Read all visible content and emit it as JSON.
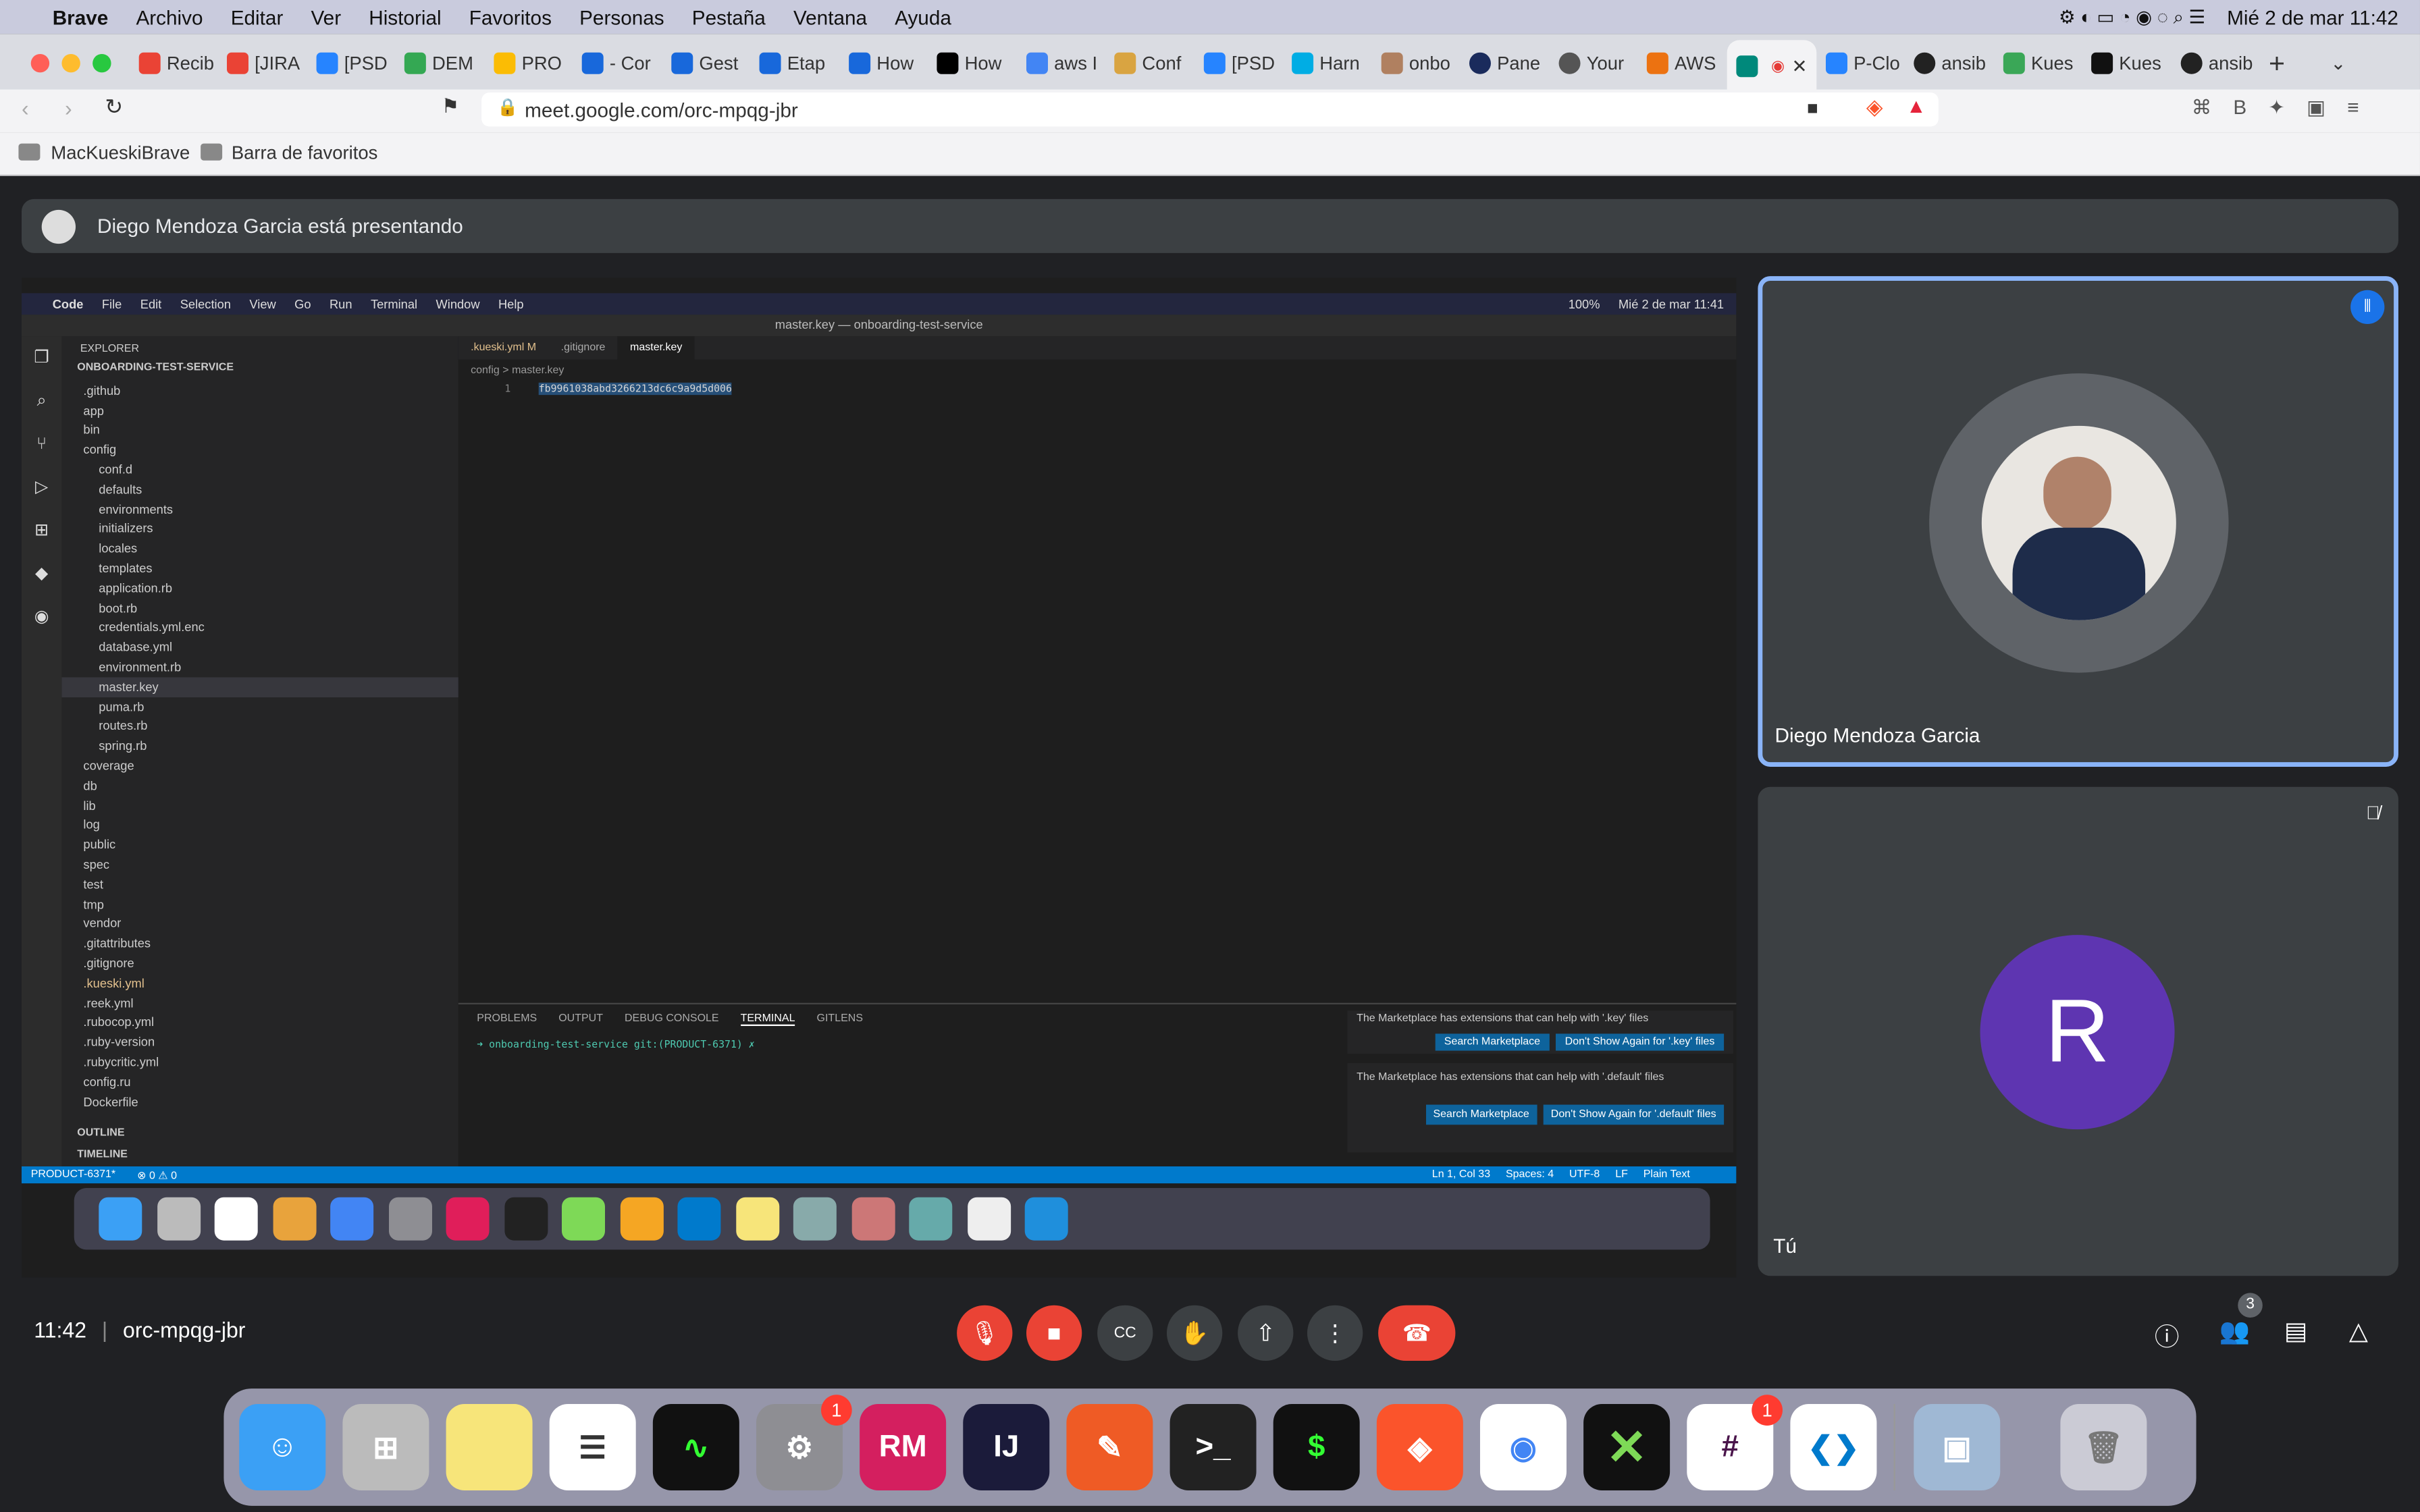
{
  "menubar": {
    "app": "Brave",
    "items": [
      "Archivo",
      "Editar",
      "Ver",
      "Historial",
      "Favoritos",
      "Personas",
      "Pestaña",
      "Ventana",
      "Ayuda"
    ],
    "datetime": "Mié 2 de mar  11:42"
  },
  "tabs": [
    "Recib",
    "[JIRA",
    "[PSD",
    "DEM",
    "PRO",
    "- Cor",
    "Gest",
    "Etap",
    "How",
    "How",
    "aws I",
    "Conf",
    "[PSD",
    "Harn",
    "onbo",
    "Pane",
    "Your",
    "AWS",
    "",
    "P-Clo",
    "ansib",
    "Kues",
    "Kues",
    "ansib"
  ],
  "browser": {
    "url": "meet.google.com/orc-mpqg-jbr",
    "bookmarks": [
      "MacKueskiBrave",
      "Barra de favoritos"
    ]
  },
  "meet": {
    "presenting": "Diego Mendoza Garcia está presentando",
    "participant1": "Diego Mendoza Garcia",
    "participant2": "Tú",
    "initial": "R",
    "time": "11:42",
    "code": "orc-mpqg-jbr",
    "people_count": "3"
  },
  "vscode": {
    "menu": [
      "Code",
      "File",
      "Edit",
      "Selection",
      "View",
      "Go",
      "Run",
      "Terminal",
      "Window",
      "Help"
    ],
    "clock": "Mié 2 de mar 11:41",
    "battery": "100%",
    "title": "master.key — onboarding-test-service",
    "explorer": "EXPLORER",
    "project": "ONBOARDING-TEST-SERVICE",
    "files": [
      ".github",
      "app",
      "bin",
      "config",
      "conf.d",
      "defaults",
      "environments",
      "initializers",
      "locales",
      "templates",
      "application.rb",
      "boot.rb",
      "credentials.yml.enc",
      "database.yml",
      "environment.rb",
      "master.key",
      "puma.rb",
      "routes.rb",
      "spring.rb",
      "coverage",
      "db",
      "lib",
      "log",
      "public",
      "spec",
      "test",
      "tmp",
      "vendor",
      ".gitattributes",
      ".gitignore",
      ".kueski.yml",
      ".reek.yml",
      ".rubocop.yml",
      ".ruby-version",
      ".rubycritic.yml",
      "config.ru",
      "Dockerfile"
    ],
    "outline": "OUTLINE",
    "timeline": "TIMELINE",
    "tabs": [
      ".kueski.yml M",
      ".gitignore",
      "master.key"
    ],
    "breadcrumb": "config  >  master.key",
    "line_no": "1",
    "code": "fb9961038abd3266213dc6c9a9d5d006",
    "panel_tabs": [
      "PROBLEMS",
      "OUTPUT",
      "DEBUG CONSOLE",
      "TERMINAL",
      "GITLENS"
    ],
    "terminal": "➜  onboarding-test-service git:(PRODUCT-6371) ✗",
    "notif1": "The Marketplace has extensions that can help with '.key' files",
    "notif2": "The Marketplace has extensions that can help with '.default' files",
    "btn_search": "Search Marketplace",
    "btn_key": "Don't Show Again for '.key' files",
    "btn_default": "Don't Show Again for '.default' files",
    "status_branch": "PRODUCT-6371*",
    "status_errors": "⊗ 0 ⚠ 0",
    "status_pos": "Ln 1, Col 33",
    "status_spaces": "Spaces: 4",
    "status_enc": "UTF-8",
    "status_eol": "LF",
    "status_lang": "Plain Text"
  },
  "dock": [
    "Finder",
    "Launchpad",
    "Notes",
    "Reminders",
    "Activity Monitor",
    "System Preferences",
    "RubyMine",
    "IntelliJ IDEA",
    "Postman",
    "Terminal",
    "iTerm",
    "Brave",
    "Chrome",
    "XMind",
    "Slack",
    "VS Code",
    "Preview",
    "Trash"
  ],
  "dock_labels": {
    "rubymine": "RM",
    "intellij": "IJ"
  },
  "badges": {
    "prefs": "1",
    "slack": "1"
  }
}
